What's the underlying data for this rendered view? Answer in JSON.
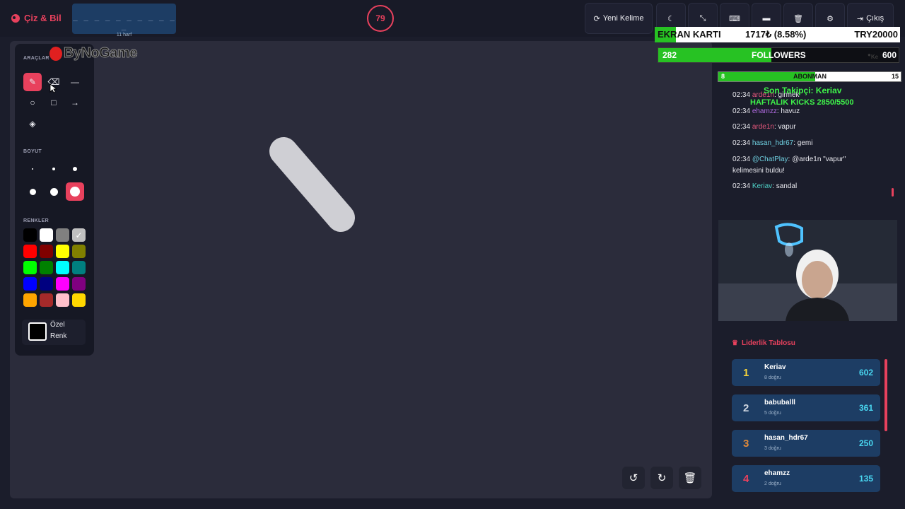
{
  "app": {
    "brand": "Çiz & Bil"
  },
  "word": {
    "dashes": "_ _ _ _ _ _ _ _ _ _ _",
    "hint": "11 harf"
  },
  "timer": {
    "value": "79"
  },
  "toolbar": {
    "new_word": "Yeni Kelime",
    "exit": "Çıkış",
    "icons": [
      "refresh-icon",
      "moon-icon",
      "compress-icon",
      "keyboard-icon",
      "box-icon",
      "trash-icon",
      "gear-icon",
      "sign-out-icon"
    ]
  },
  "overlay": {
    "ekran": {
      "label": "EKRAN KARTI",
      "value": "1717₺ (8.58%)",
      "goal": "TRY20000",
      "progress": 0.0858
    },
    "followers": {
      "count": "282",
      "label": "FOLLOWERS",
      "goal": "600",
      "small": "Ke",
      "progress": 0.47
    },
    "abone": {
      "current": "8",
      "label": "ABONMAN",
      "goal": "15",
      "progress": 0.53
    },
    "last_follower": "Son Takipçi: Keriav",
    "kicks": "HAFTALIK KICKS 2850/5500",
    "logo": "ByNoGame"
  },
  "tools": {
    "section_tools": "ARAÇLAR",
    "section_size": "BOYUT",
    "section_colors": "RENKLER",
    "custom_color": [
      "Özel",
      "Renk"
    ],
    "colors": [
      "#000000",
      "#ffffff",
      "#808080",
      "#c0c0c0",
      "#ff0000",
      "#800000",
      "#ffff00",
      "#808000",
      "#00ff00",
      "#008000",
      "#00ffff",
      "#008080",
      "#0000ff",
      "#000080",
      "#ff00ff",
      "#800080",
      "#ffa500",
      "#a52a2a",
      "#ffc0cb",
      "#ffd700"
    ]
  },
  "chat": [
    {
      "time": "02:34",
      "user": "arde1n",
      "color": "#e0567a",
      "msg": "girmek"
    },
    {
      "time": "02:34",
      "user": "ehamzz",
      "color": "#b06be0",
      "msg": "havuz"
    },
    {
      "time": "02:34",
      "user": "arde1n",
      "color": "#e0567a",
      "msg": "vapur"
    },
    {
      "time": "02:34",
      "user": "hasan_hdr67",
      "color": "#6fd0e0",
      "msg": "gemi"
    },
    {
      "time": "02:34",
      "user": "@ChatPlay",
      "color": "#6fd0e0",
      "msg": "@arde1n \"vapur\"",
      "msg2": "kelimesini buldu!"
    },
    {
      "time": "02:34",
      "user": "Keriav",
      "color": "#4fd3c8",
      "msg": "sandal"
    }
  ],
  "leaderboard": {
    "title": "Liderlik Tablosu",
    "rows": [
      {
        "rank": "1",
        "name": "Keriav",
        "sub": "8 doğru",
        "score": "602",
        "color": "#f5d33b"
      },
      {
        "rank": "2",
        "name": "babuballl",
        "sub": "5 doğru",
        "score": "361",
        "color": "#cfd6e0"
      },
      {
        "rank": "3",
        "name": "hasan_hdr67",
        "sub": "3 doğru",
        "score": "250",
        "color": "#e08a3a"
      },
      {
        "rank": "4",
        "name": "ehamzz",
        "sub": "2 doğru",
        "score": "135",
        "color": "#e8415d"
      }
    ]
  }
}
